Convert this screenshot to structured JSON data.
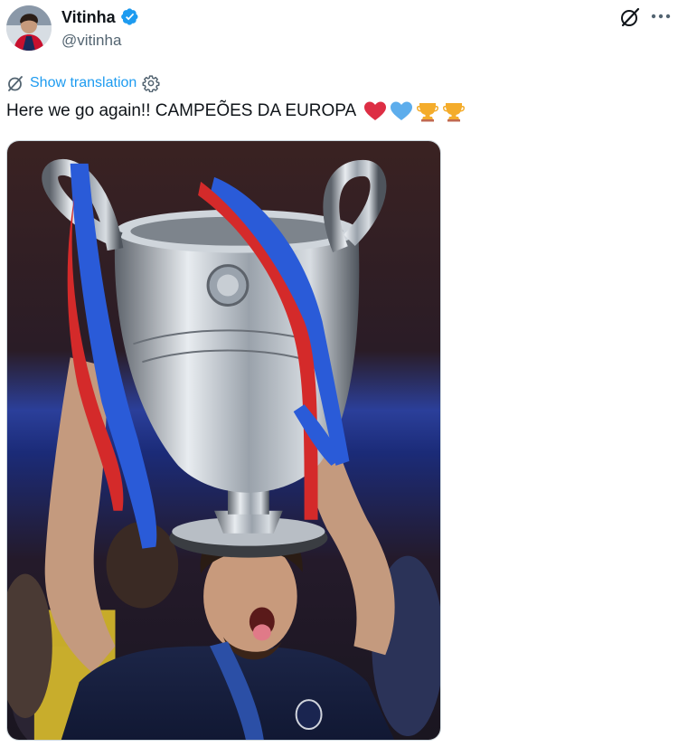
{
  "author": {
    "display_name": "Vitinha",
    "handle": "@vitinha",
    "verified_icon": "verified-badge-icon",
    "avatar_icon": "avatar"
  },
  "actions": {
    "grok_icon": "grok-icon",
    "more_icon": "more-options-icon"
  },
  "translation": {
    "label": "Show translation",
    "icon": "translate-icon",
    "settings_icon": "gear-icon"
  },
  "tweet": {
    "text": "Here we go again!! CAMPEÕES DA EUROPA",
    "emojis": [
      "red-heart",
      "blue-heart",
      "trophy",
      "trophy"
    ]
  },
  "colors": {
    "accent": "#1d9bf0",
    "text": "#0f1419",
    "secondary": "#536471"
  }
}
